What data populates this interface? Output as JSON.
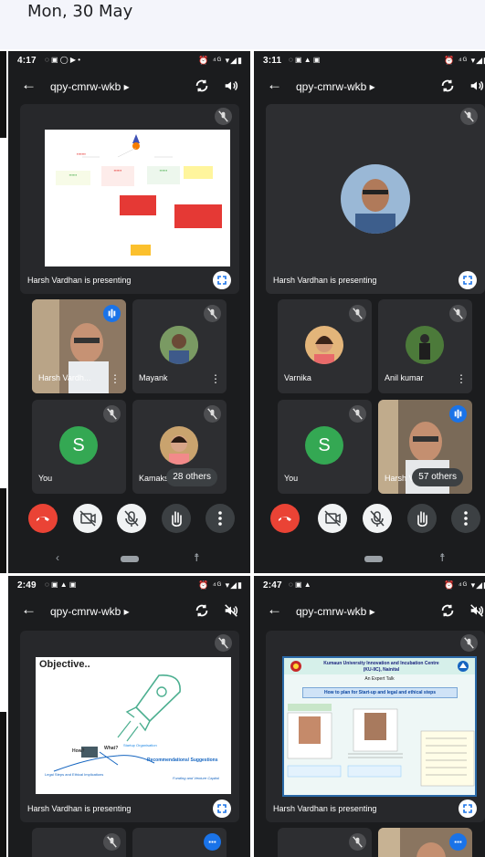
{
  "date_header": "Mon, 30 May",
  "colors": {
    "end_call": "#ea4335",
    "speaking": "#1a73e8",
    "avatar_s": "#34a853",
    "tile_bg": "#2d2e31",
    "page_bg": "#1b1c1e"
  },
  "phones": [
    {
      "time": "4:17",
      "status_icons": "⏰ ⁴ᴳ ▾◢▮",
      "meeting_code": "qpy-cmrw-wkb",
      "presenting_label": "Harsh Vardhan is presenting",
      "tiles": [
        {
          "name": "Harsh Vardh..."
        },
        {
          "name": "Mayank"
        },
        {
          "name": "You",
          "avatar_letter": "S"
        },
        {
          "name": "Kamaksh",
          "others": "28 others"
        }
      ]
    },
    {
      "time": "3:11",
      "status_icons": "⏰ ⁴ᴳ ▾◢▮",
      "meeting_code": "qpy-cmrw-wkb",
      "presenting_label": "Harsh Vardhan is presenting",
      "tiles": [
        {
          "name": "Varnika"
        },
        {
          "name": "Anil kumar"
        },
        {
          "name": "You",
          "avatar_letter": "S"
        },
        {
          "name": "Harsh V",
          "others": "57 others"
        }
      ]
    },
    {
      "time": "2:49",
      "status_icons": "⏰ ⁴ᴳ ▾◢▮",
      "meeting_code": "qpy-cmrw-wkb",
      "presenting_label": "Harsh Vardhan is presenting",
      "slide": {
        "title": "Objective..",
        "sub_a": "Startup Organisation",
        "sub_b": "How?",
        "sub_c": "What?",
        "sub_d": "Legal Steps and Ethical Implications",
        "sub_e": "Recommendations/ Suggestions",
        "sub_f": "Funding and Venture Capital"
      }
    },
    {
      "time": "2:47",
      "status_icons": "⏰ ⁴ᴳ ▾◢▮",
      "meeting_code": "qpy-cmrw-wkb",
      "presenting_label": "Harsh Vardhan is presenting",
      "slide": {
        "title": "Kumaun University Innovation and Incubation Centre",
        "subtitle": "(KU-IIC), Nainital",
        "event": "An Expert Talk",
        "topic": "How to plan for Start-up and legal and ethical steps"
      }
    }
  ]
}
